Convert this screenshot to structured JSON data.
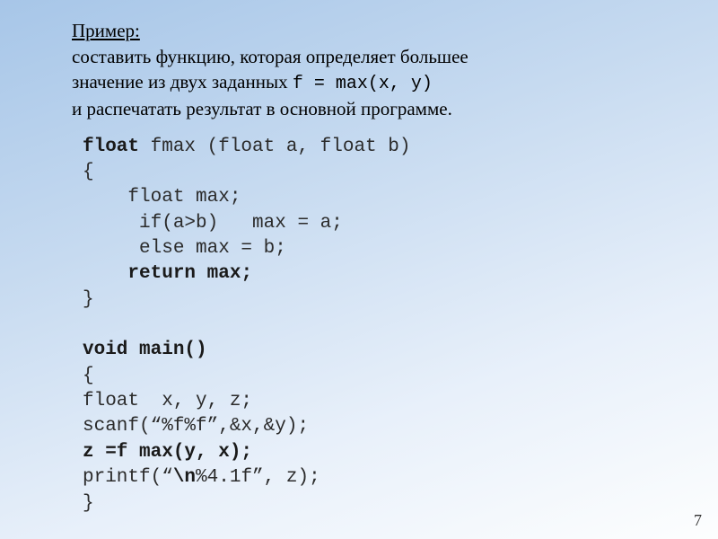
{
  "slide": {
    "title": "Пример:",
    "desc_line1": "составить функцию, которая определяет большее",
    "desc_line2_a": "значение из двух заданных ",
    "desc_line2_code": "f  = max(x, y)",
    "desc_line3": "и распечатать результат в основной программе.",
    "code": {
      "l1a": "float",
      "l1b": " fmax (float a, float b)",
      "l2": "{",
      "l3": "    float max;",
      "l4": "     if(a>b)   max = a;",
      "l5": "     else max = b;",
      "l6a": "    ",
      "l6b": "return max;",
      "l7": "}",
      "l8": "",
      "l9": "void main()",
      "l10": "{",
      "l11": "float  x, y, z;",
      "l12": "scanf(“%f%f”,&x,&y);",
      "l13": "z =f max(y, x);",
      "l14a": "printf(“",
      "l14b": "\\n",
      "l14c": "%4.1f”, z);",
      "l15": "}"
    },
    "page_number": "7"
  }
}
